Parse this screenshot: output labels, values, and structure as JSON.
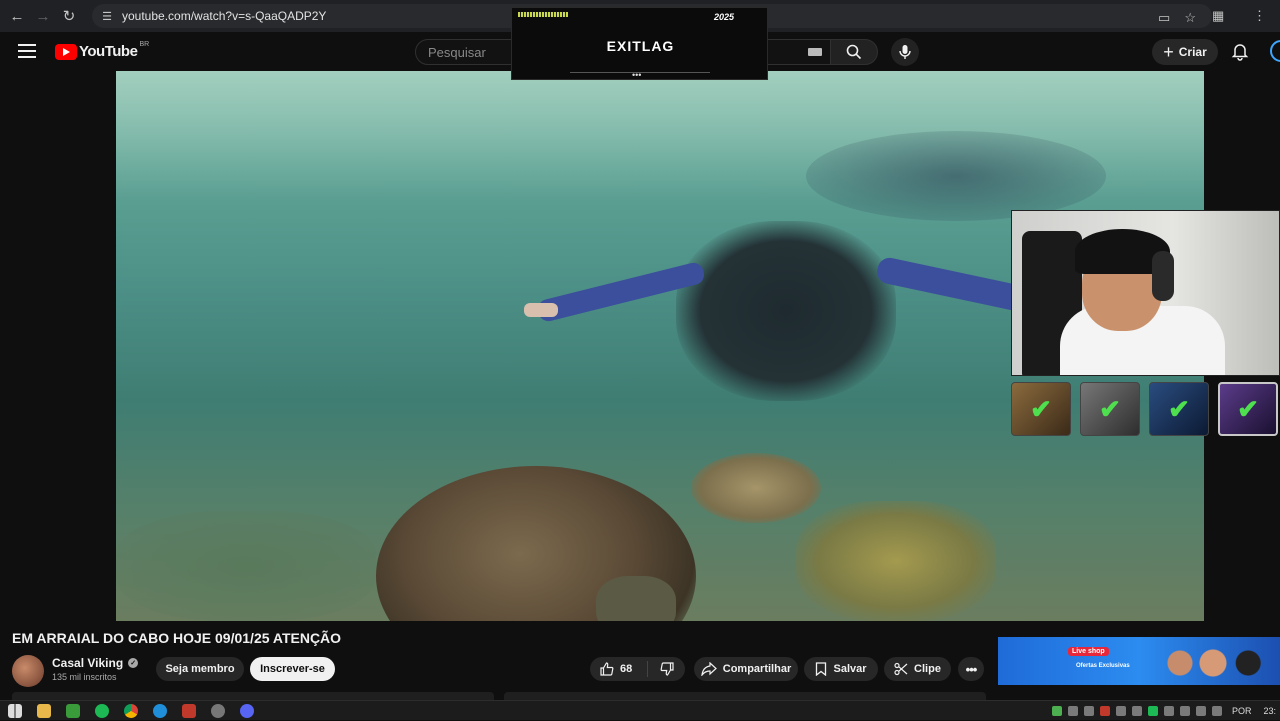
{
  "browser": {
    "url": "youtube.com/watch?v=s-QaaQADP2Y",
    "icons": [
      "back-icon",
      "forward-icon",
      "reload-icon",
      "site-settings-icon",
      "cast-icon",
      "star-icon",
      "extensions-icon",
      "menu-icon"
    ]
  },
  "header": {
    "logo_text": "YouTube",
    "country_code": "BR",
    "search_placeholder": "Pesquisar",
    "create_label": "Criar"
  },
  "overlay": {
    "exitlag_year": "2025",
    "exitlag_brand": "EXITLAG",
    "exitlag_dots": "•••"
  },
  "video": {
    "title": "EM ARRAIAL DO CABO HOJE 09/01/25 ATENÇÃO",
    "channel": "Casal Viking",
    "subscribers": "135 mil inscritos",
    "member_label": "Seja membro",
    "subscribe_label": "Inscrever-se",
    "likes": "68",
    "share_label": "Compartilhar",
    "save_label": "Salvar",
    "clip_label": "Clipe",
    "more_label": "•••"
  },
  "ad": {
    "tag": "Live shop",
    "offers": "Ofertas Exclusivas"
  },
  "taskbar": {
    "language": "POR",
    "clock": "23:"
  }
}
